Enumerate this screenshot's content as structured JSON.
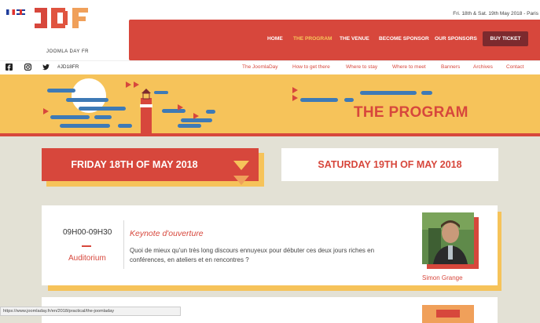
{
  "topbar": {
    "date_location": "Fri. 18th & Sat. 19th May 2018 - Paris"
  },
  "logo": {
    "tagline": "JOOMLA DAY FR"
  },
  "nav": {
    "items": [
      {
        "label": "HOME"
      },
      {
        "label": "THE PROGRAM"
      },
      {
        "label": "THE VENUE"
      },
      {
        "label": "BECOME SPONSOR"
      },
      {
        "label": "OUR SPONSORS"
      }
    ],
    "buy_ticket": "BUY TICKET"
  },
  "subbar": {
    "hashtag": "#JD18FR",
    "links": [
      {
        "label": "The JoomlaDay"
      },
      {
        "label": "How to get there"
      },
      {
        "label": "Where to stay"
      },
      {
        "label": "Where to meet"
      },
      {
        "label": "Banners"
      },
      {
        "label": "Archives"
      },
      {
        "label": "Contact"
      }
    ]
  },
  "banner": {
    "title": "THE PROGRAM"
  },
  "days": [
    {
      "label": "FRIDAY 18TH OF MAY 2018"
    },
    {
      "label": "SATURDAY 19TH OF MAY 2018"
    }
  ],
  "sessions": [
    {
      "time": "09H00-09H30",
      "room": "Auditorium",
      "title": "Keynote d'ouverture",
      "description": "Quoi de mieux qu'un très long discours ennuyeux pour débuter ces deux jours riches en conférences, en ateliers et en rencontres ?",
      "speaker": "Simon Grange"
    }
  ],
  "statusbar": {
    "url": "https://www.joomladay.fr/en/2018/practical/the-joomladay"
  },
  "colors": {
    "accent_red": "#d7473c",
    "accent_yellow": "#f6c35a",
    "dark_red": "#7c2a2e",
    "background": "#e3e1d5"
  },
  "icons": [
    "flag-fr-icon",
    "flag-uk-icon",
    "facebook-icon",
    "instagram-icon",
    "twitter-icon",
    "chevron-down-icon",
    "lighthouse-icon",
    "speaker-photo"
  ]
}
